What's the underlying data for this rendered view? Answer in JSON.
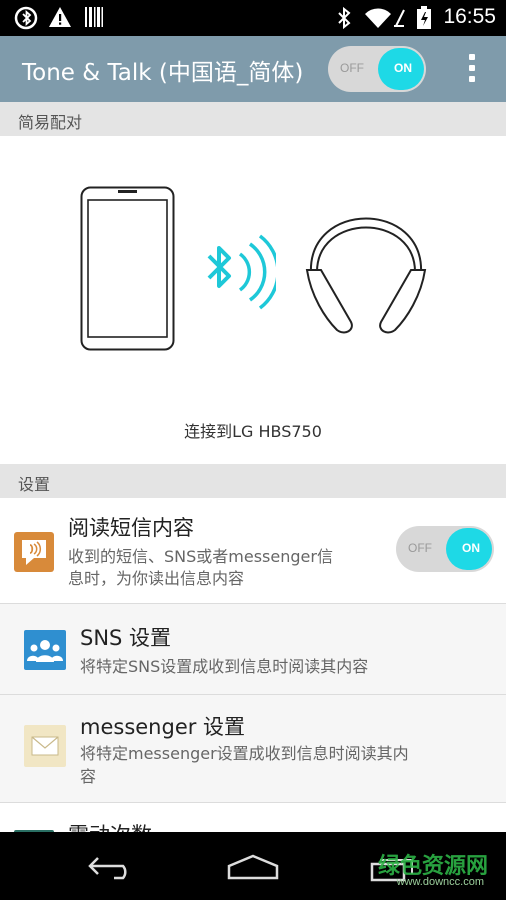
{
  "status_bar": {
    "time": "16:55",
    "left_icons": [
      "bluetooth-settings-icon",
      "warning-icon",
      "barcode-icon"
    ],
    "right_icons": [
      "bluetooth-icon",
      "wifi-icon",
      "battery-charging-icon"
    ]
  },
  "app_bar": {
    "title": "Tone & Talk (中国语_简体)",
    "toggle": {
      "off_label": "OFF",
      "on_label": "ON",
      "state": "on"
    },
    "menu_icon": "overflow-menu-icon",
    "background_color": "#7f9bab"
  },
  "pairing": {
    "section_label": "简易配对",
    "caption": "连接到LG HBS750",
    "accent_color": "#1ec8d8"
  },
  "settings": {
    "section_label": "设置",
    "read_messages": {
      "title": "阅读短信内容",
      "subtitle_line1": "收到的短信、SNS或者messenger信",
      "subtitle_line2": "息时，为你读出信息内容",
      "toggle": {
        "off_label": "OFF",
        "on_label": "ON",
        "state": "on"
      }
    },
    "sns": {
      "title": "SNS 设置",
      "subtitle": "将特定SNS设置成收到信息时阅读其内容"
    },
    "messenger": {
      "title": "messenger 设置",
      "subtitle_line1": "将特定messenger设置成收到信息时阅读其内",
      "subtitle_line2": "容"
    },
    "vibration": {
      "title": "震动次数"
    }
  },
  "nav_bar": {
    "buttons": [
      "back-icon",
      "home-icon",
      "recents-icon"
    ]
  },
  "watermark": {
    "text": "绿色资源网",
    "url": "www.downcc.com"
  }
}
